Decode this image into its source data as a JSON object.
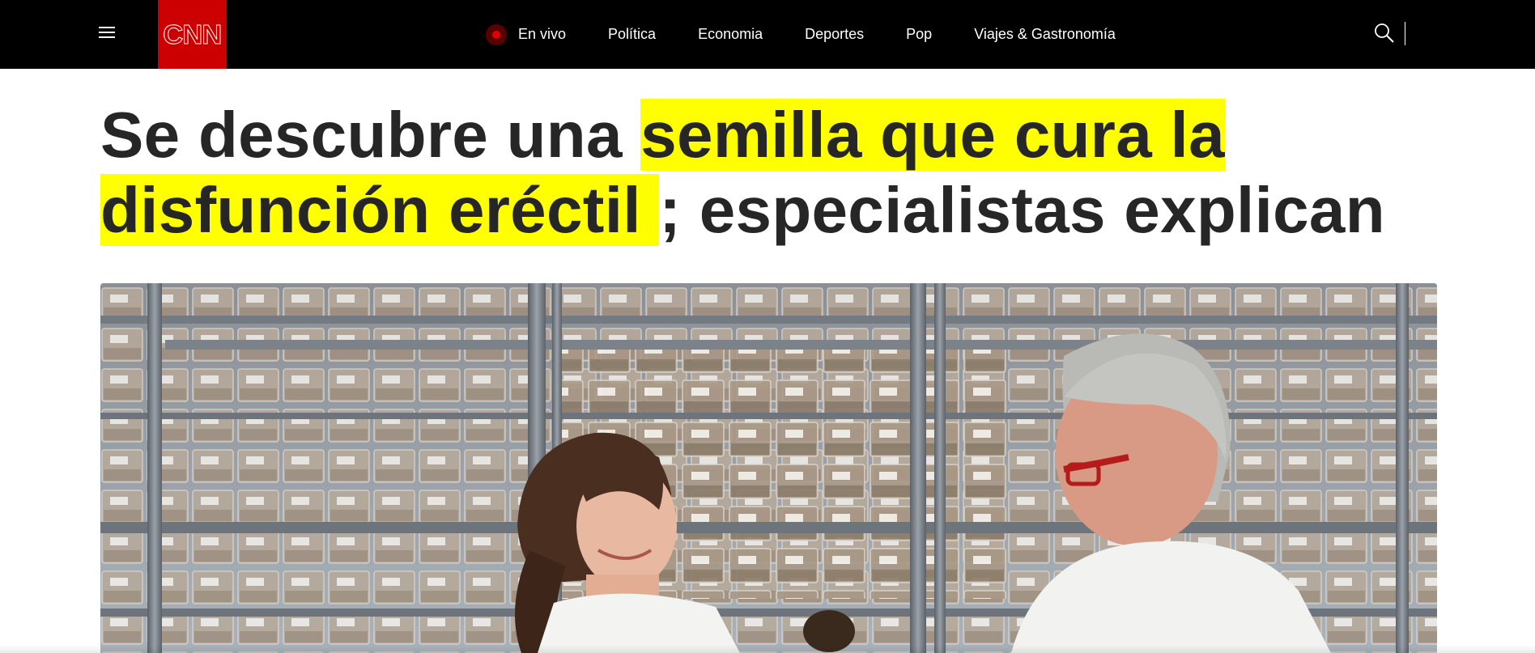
{
  "header": {
    "logo_text": "CNN",
    "nav": [
      {
        "label": "En vivo",
        "live": true
      },
      {
        "label": "Política"
      },
      {
        "label": "Economia"
      },
      {
        "label": "Deportes"
      },
      {
        "label": "Pop"
      },
      {
        "label": "Viajes & Gastronomía"
      }
    ],
    "colors": {
      "background": "#000000",
      "logo": "#cc0000",
      "live": "#e00000"
    },
    "icons": [
      "menu-icon",
      "search-icon"
    ]
  },
  "article": {
    "headline_part1": "Se descubre una ",
    "headline_highlight1": "semilla que cura la",
    "headline_highlight2": "disfunción eréctil ",
    "headline_part2": "; especialistas explican",
    "highlight_color": "#ffff00"
  }
}
